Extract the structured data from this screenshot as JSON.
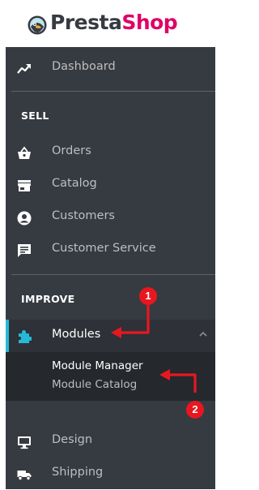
{
  "logo": {
    "part1": "Presta",
    "part2": "Shop"
  },
  "nav": {
    "dashboard": "Dashboard",
    "sell_heading": "SELL",
    "orders": "Orders",
    "catalog": "Catalog",
    "customers": "Customers",
    "customer_service": "Customer Service",
    "improve_heading": "IMPROVE",
    "modules": "Modules",
    "module_manager": "Module Manager",
    "module_catalog": "Module Catalog",
    "design": "Design",
    "shipping": "Shipping"
  },
  "annotations": {
    "step1": "1",
    "step2": "2"
  },
  "colors": {
    "sidebar_bg": "#363a41",
    "active_indicator": "#25b9d7",
    "brand_pink": "#df0067",
    "annotation_red": "#e8171f"
  }
}
